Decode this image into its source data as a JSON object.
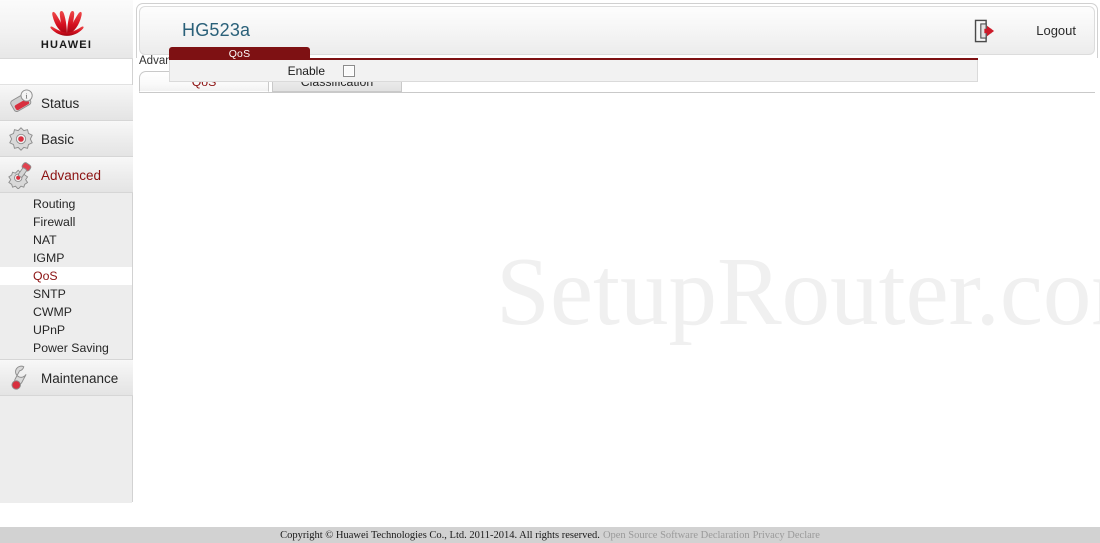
{
  "brand": {
    "logo_icon": "huawei-logo-icon",
    "wordmark": "HUAWEI"
  },
  "header": {
    "device_title": "HG523a",
    "logout_label": "Logout",
    "logout_icon": "logout-door-arrow-icon"
  },
  "breadcrumb": {
    "text": "Advanced > QoS > QoS"
  },
  "sidebar": {
    "sections": [
      {
        "label": "Status",
        "icon": "status-info-icon",
        "active": false
      },
      {
        "label": "Basic",
        "icon": "gear-icon",
        "active": false
      },
      {
        "label": "Advanced",
        "icon": "gear-wrench-icon",
        "active": true
      },
      {
        "label": "Maintenance",
        "icon": "wrench-icon",
        "active": false
      }
    ],
    "advanced_items": [
      {
        "label": "Routing",
        "active": false
      },
      {
        "label": "Firewall",
        "active": false
      },
      {
        "label": "NAT",
        "active": false
      },
      {
        "label": "IGMP",
        "active": false
      },
      {
        "label": "QoS",
        "active": true
      },
      {
        "label": "SNTP",
        "active": false
      },
      {
        "label": "CWMP",
        "active": false
      },
      {
        "label": "UPnP",
        "active": false
      },
      {
        "label": "Power Saving",
        "active": false
      }
    ]
  },
  "tabs": [
    {
      "label": "QoS",
      "active": true
    },
    {
      "label": "Classification",
      "active": false
    }
  ],
  "qos_panel": {
    "title": "QoS",
    "enable_label": "Enable",
    "enable_checked": false
  },
  "watermark": {
    "text": "SetupRouter.com"
  },
  "footer": {
    "copyright": "Copyright © Huawei Technologies Co., Ltd. 2011-2014. All rights reserved.",
    "link_open_source": "Open Source Software Declaration",
    "link_privacy": "Privacy Declare"
  },
  "colors": {
    "brand_red": "#c8102e",
    "panel_header_red": "#7e1113",
    "active_text_red": "#8c1212",
    "title_blue": "#2a6079",
    "sidebar_bg": "#ededed",
    "footer_bg": "#d2d2d2"
  }
}
